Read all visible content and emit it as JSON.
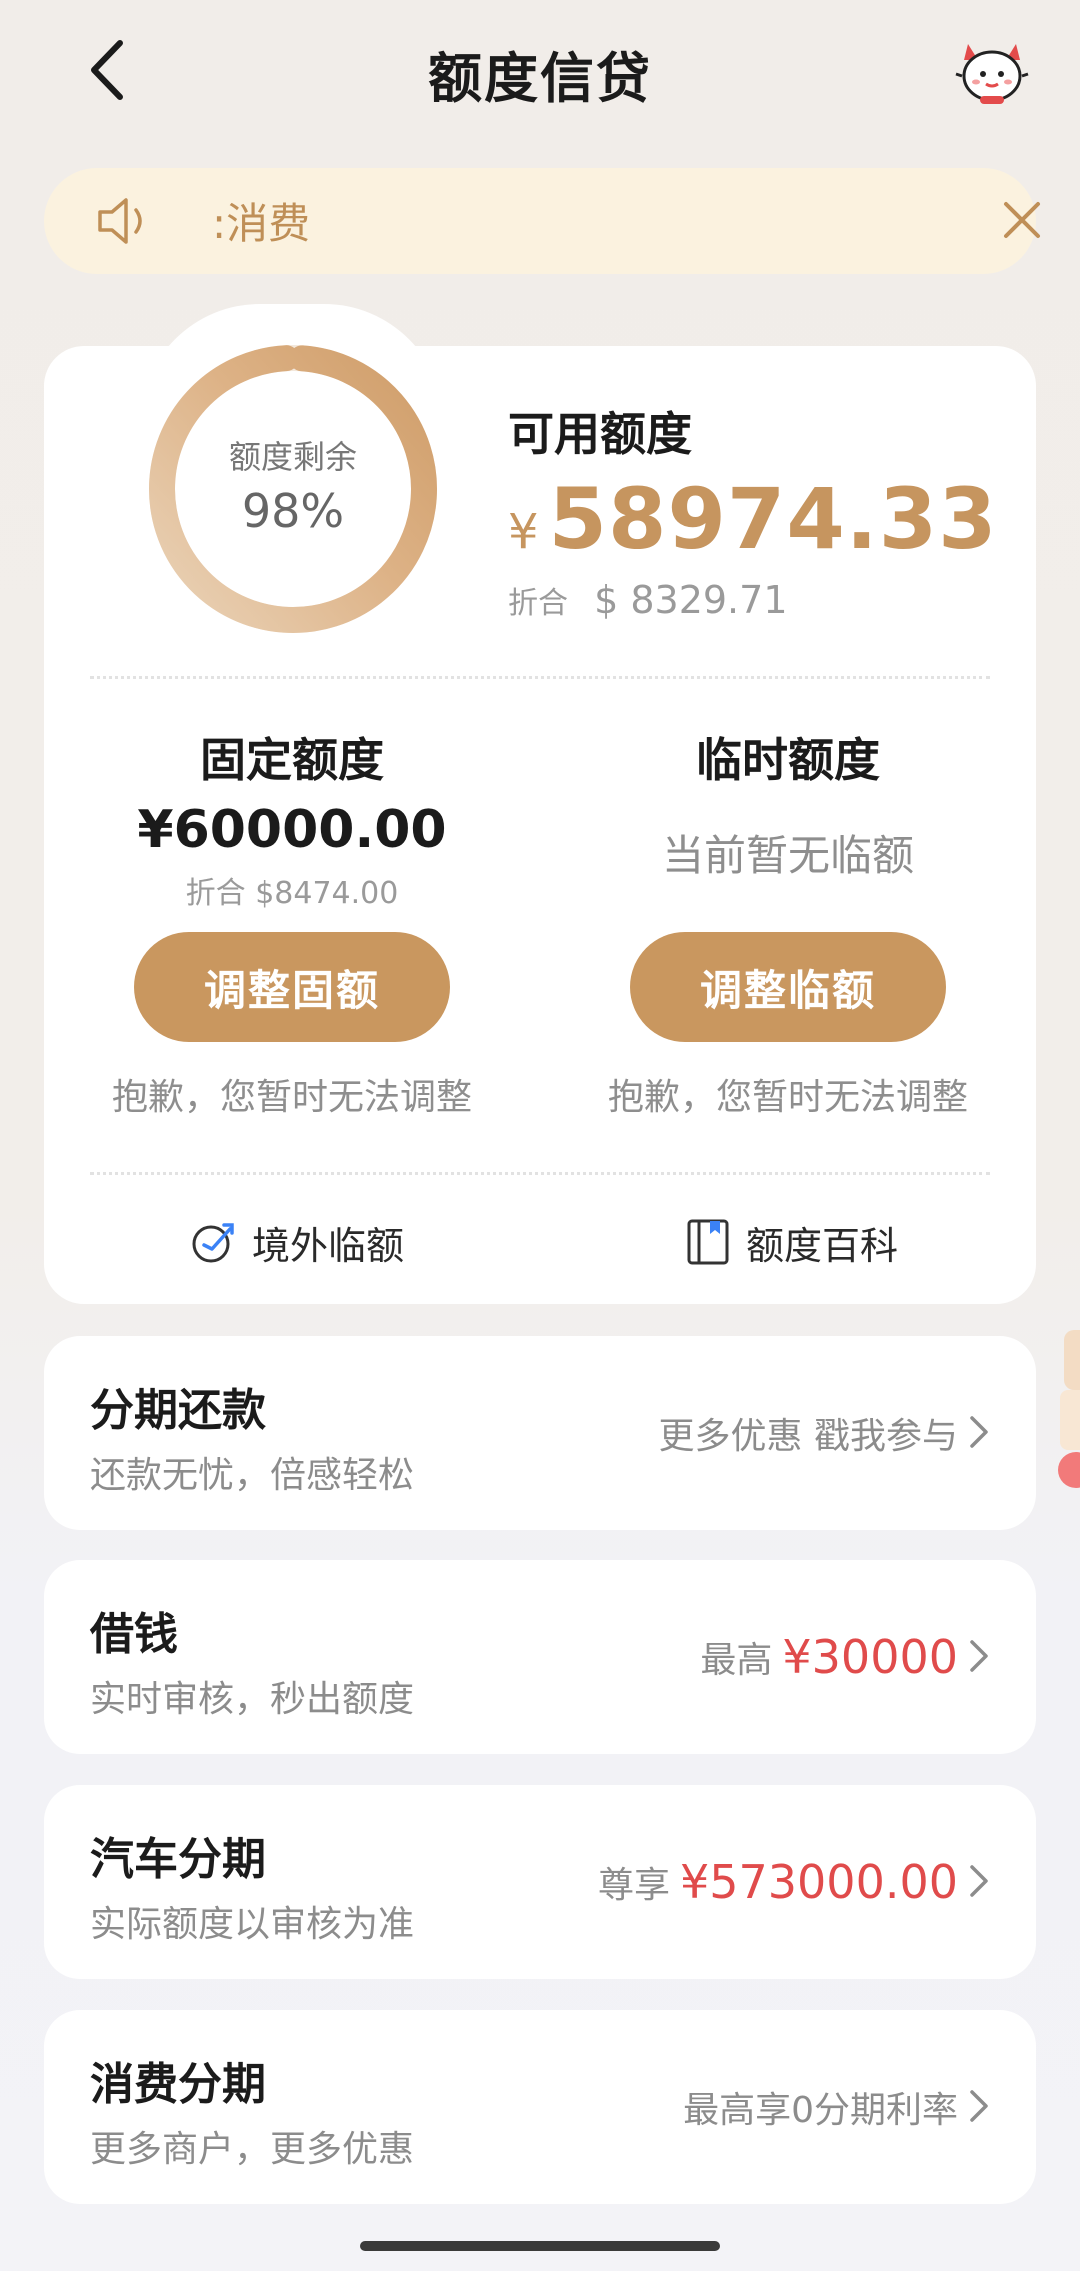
{
  "header": {
    "title": "额度信贷",
    "back_icon": "chevron-left-icon",
    "mascot_icon": "mascot-avatar-icon"
  },
  "notice": {
    "text": ":消费",
    "icon": "speaker-icon",
    "close_icon": "close-icon"
  },
  "credit": {
    "ring_label": "额度剩余",
    "ring_percent": "98%",
    "ring_fraction": 0.98,
    "available_title": "可用额度",
    "available_currency": "¥",
    "available_amount": "58974.33",
    "converted_label": "折合",
    "converted_amount": "$ 8329.71",
    "fixed": {
      "title": "固定额度",
      "amount": "¥60000.00",
      "converted": "折合 $8474.00",
      "button": "调整固额",
      "note": "抱歉，您暂时无法调整"
    },
    "temporary": {
      "title": "临时额度",
      "status": "当前暂无临额",
      "button": "调整临额",
      "note": "抱歉，您暂时无法调整"
    },
    "links": [
      {
        "label": "境外临额",
        "icon": "plane-globe-icon"
      },
      {
        "label": "额度百科",
        "icon": "book-icon"
      }
    ]
  },
  "services": [
    {
      "title": "分期还款",
      "subtitle": "还款无忧，倍感轻松",
      "right_text": "更多优惠 戳我参与",
      "right_prefix": "",
      "right_highlight": ""
    },
    {
      "title": "借钱",
      "subtitle": "实时审核，秒出额度",
      "right_text": "",
      "right_prefix": "最高",
      "right_highlight": "¥30000"
    },
    {
      "title": "汽车分期",
      "subtitle": "实际额度以审核为准",
      "right_text": "",
      "right_prefix": "尊享",
      "right_highlight": "¥573000.00"
    },
    {
      "title": "消费分期",
      "subtitle": "更多商户，更多优惠",
      "right_text": "最高享0分期利率",
      "right_prefix": "",
      "right_highlight": ""
    }
  ],
  "colors": {
    "accent": "#c9975f",
    "highlight_red": "#e04b4b",
    "notice_bg": "#fbf2df"
  }
}
